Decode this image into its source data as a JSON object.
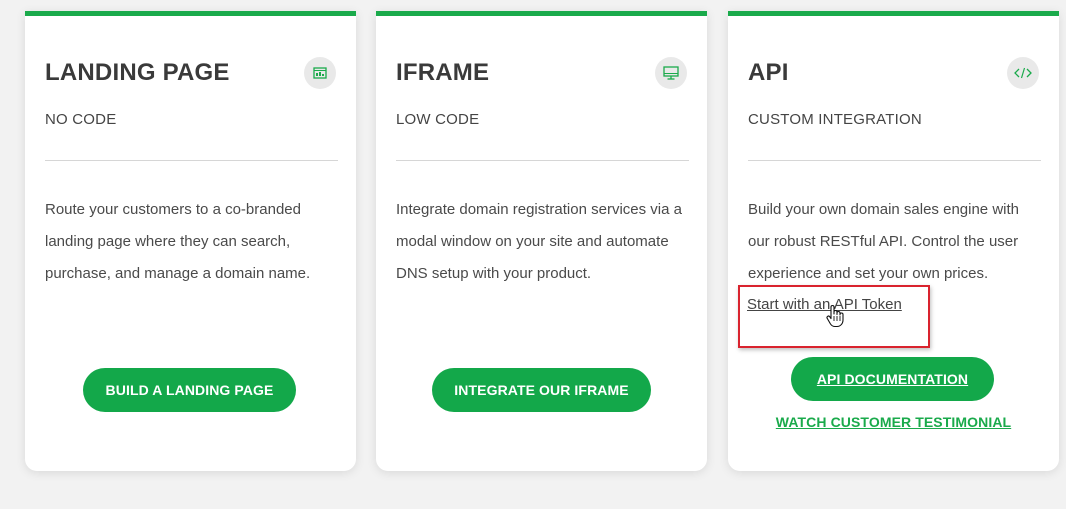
{
  "cards": [
    {
      "title": "LANDING PAGE",
      "subtitle": "NO CODE",
      "icon": "landing-page-icon",
      "description": "Route your customers to a co-branded landing page where they can search, purchase, and manage a domain name.",
      "button_label": "BUILD A LANDING PAGE"
    },
    {
      "title": "IFRAME",
      "subtitle": "LOW CODE",
      "icon": "monitor-icon",
      "description": "Integrate domain registration services via a modal window on your site and automate DNS setup with your product.",
      "button_label": "INTEGRATE OUR IFRAME"
    },
    {
      "title": "API",
      "subtitle": "CUSTOM INTEGRATION",
      "icon": "code-icon",
      "description": "Build your own domain sales engine with our robust RESTful API. Control the user experience and set your own prices.",
      "link_label": "Start with an API Token",
      "button_label": "API DOCUMENTATION",
      "secondary_link_label": "WATCH CUSTOMER TESTIMONIAL"
    }
  ],
  "colors": {
    "accent": "#1aaa4b",
    "button": "#13a84a",
    "highlight": "#d9232e",
    "background": "#f2f2f2"
  }
}
